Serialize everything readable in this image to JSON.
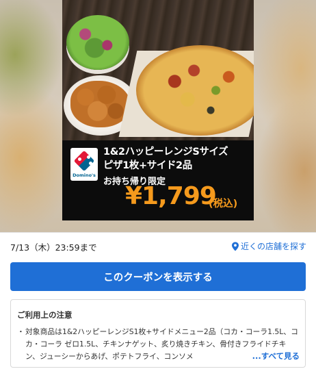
{
  "promo": {
    "title_line1": "1&2ハッピーレンジSサイズ",
    "title_line2": "ピザ1枚+サイド2品",
    "subtitle": "お持ち帰り限定",
    "price": "¥1,799",
    "tax_note": "(税込)",
    "brand": "Domino's",
    "brand_colors": {
      "red": "#e31837",
      "blue": "#006491"
    },
    "price_color": "#f59a1d"
  },
  "info": {
    "deadline": "7/13（木）23:59まで",
    "store_link": "近くの店舗を探す",
    "link_color": "#1f6fd6"
  },
  "action": {
    "show_coupon": "このクーポンを表示する"
  },
  "notes": {
    "title": "ご利用上の注意",
    "bullet": "・",
    "text": "対象商品は1&2ハッピーレンジS1枚+サイドメニュー2品（コカ・コーラ1.5L、コカ・コーラ ゼロ1.5L、チキンナゲット、炙り焼きチキン、骨付きフライドチキン、ジューシーからあげ、ポテトフライ、コンソメ",
    "more": "...すべて見る"
  }
}
